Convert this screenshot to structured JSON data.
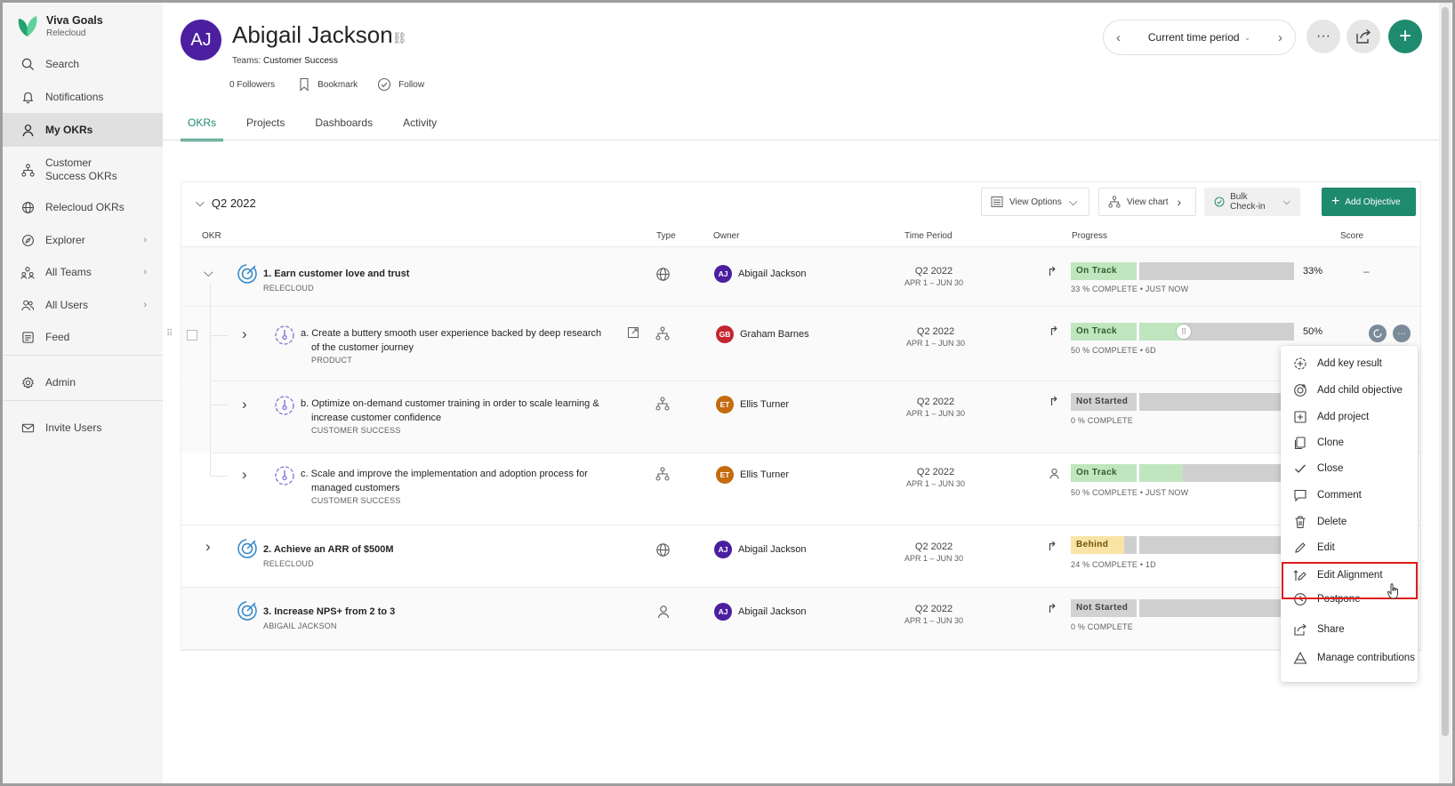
{
  "brand": {
    "name": "Viva Goals",
    "org": "Relecloud"
  },
  "sidebar": {
    "items": [
      {
        "label": "Search"
      },
      {
        "label": "Notifications"
      },
      {
        "label": "My OKRs"
      },
      {
        "label": "Customer Success OKRs"
      },
      {
        "label": "Relecloud OKRs"
      },
      {
        "label": "Explorer"
      },
      {
        "label": "All Teams"
      },
      {
        "label": "All Users"
      },
      {
        "label": "Feed"
      },
      {
        "label": "Admin"
      },
      {
        "label": "Invite Users"
      }
    ]
  },
  "profile": {
    "initials": "AJ",
    "name": "Abigail Jackson",
    "teams_label": "Teams:",
    "teams_value": "Customer Success",
    "followers": "0 Followers",
    "bookmark": "Bookmark",
    "follow": "Follow"
  },
  "header": {
    "period": "Current time period"
  },
  "tabs": [
    {
      "label": "OKRs"
    },
    {
      "label": "Projects"
    },
    {
      "label": "Dashboards"
    },
    {
      "label": "Activity"
    }
  ],
  "section": {
    "title": "Q2 2022"
  },
  "toolbar": {
    "view_options": "View Options",
    "view_chart": "View chart",
    "bulk_checkin": "Bulk Check-in",
    "add_objective": "Add Objective"
  },
  "columns": {
    "okr": "OKR",
    "type": "Type",
    "owner": "Owner",
    "time_period": "Time Period",
    "progress": "Progress",
    "score": "Score"
  },
  "rows": [
    {
      "title": "1. Earn customer love and trust",
      "subtitle": "RELECLOUD",
      "owner": "Abigail Jackson",
      "owner_initials": "AJ",
      "owner_color": "#4b1fa0",
      "period": "Q2 2022",
      "range": "APR 1 – JUN 30",
      "status": "On Track",
      "progress": 0.33,
      "percent": "33%",
      "meta": "33 % COMPLETE • JUST NOW",
      "score": "–"
    },
    {
      "title": "a. Create a buttery smooth user experience backed by deep research",
      "title2": "of the customer journey",
      "subtitle": "PRODUCT",
      "owner": "Graham Barnes",
      "owner_initials": "GB",
      "owner_color": "#c4262e",
      "period": "Q2 2022",
      "range": "APR 1 – JUN 30",
      "status": "On Track",
      "progress": 0.5,
      "percent": "50%",
      "meta": "50 % COMPLETE • 6D"
    },
    {
      "title": "b. Optimize on-demand customer training in order to scale learning &",
      "title2": "increase customer confidence",
      "subtitle": "CUSTOMER SUCCESS",
      "owner": "Ellis Turner",
      "owner_initials": "ET",
      "owner_color": "#c36b0e",
      "period": "Q2 2022",
      "range": "APR 1 – JUN 30",
      "status": "Not Started",
      "progress": 0,
      "meta": "0 % COMPLETE"
    },
    {
      "title": "c. Scale and improve the implementation and adoption process for",
      "title2": "managed customers",
      "subtitle": "CUSTOMER SUCCESS",
      "owner": "Ellis Turner",
      "owner_initials": "ET",
      "owner_color": "#c36b0e",
      "period": "Q2 2022",
      "range": "APR 1 – JUN 30",
      "status": "On Track",
      "progress": 0.5,
      "meta": "50 % COMPLETE • JUST NOW"
    },
    {
      "title": "2. Achieve an ARR of $500M",
      "subtitle": "RELECLOUD",
      "owner": "Abigail Jackson",
      "owner_initials": "AJ",
      "owner_color": "#4b1fa0",
      "period": "Q2 2022",
      "range": "APR 1 – JUN 30",
      "status": "Behind",
      "progress": 0.24,
      "meta": "24 % COMPLETE • 1D"
    },
    {
      "title": "3. Increase NPS+ from 2 to 3",
      "subtitle": "ABIGAIL JACKSON",
      "owner": "Abigail Jackson",
      "owner_initials": "AJ",
      "owner_color": "#4b1fa0",
      "period": "Q2 2022",
      "range": "APR 1 – JUN 30",
      "status": "Not Started",
      "progress": 0,
      "meta": "0 % COMPLETE"
    }
  ],
  "menu": {
    "items": [
      {
        "label": "Add key result"
      },
      {
        "label": "Add child objective"
      },
      {
        "label": "Add project"
      },
      {
        "label": "Clone"
      },
      {
        "label": "Close"
      },
      {
        "label": "Comment"
      },
      {
        "label": "Delete"
      },
      {
        "label": "Edit"
      },
      {
        "label": "Edit Alignment"
      },
      {
        "label": "Postpone"
      },
      {
        "label": "Share"
      },
      {
        "label": "Manage contributions"
      }
    ]
  },
  "colors": {
    "accent": "#1e8a6e",
    "on_track": "#bfe6bf",
    "behind": "#f9e3a6",
    "highlight": "#e01b1b"
  }
}
